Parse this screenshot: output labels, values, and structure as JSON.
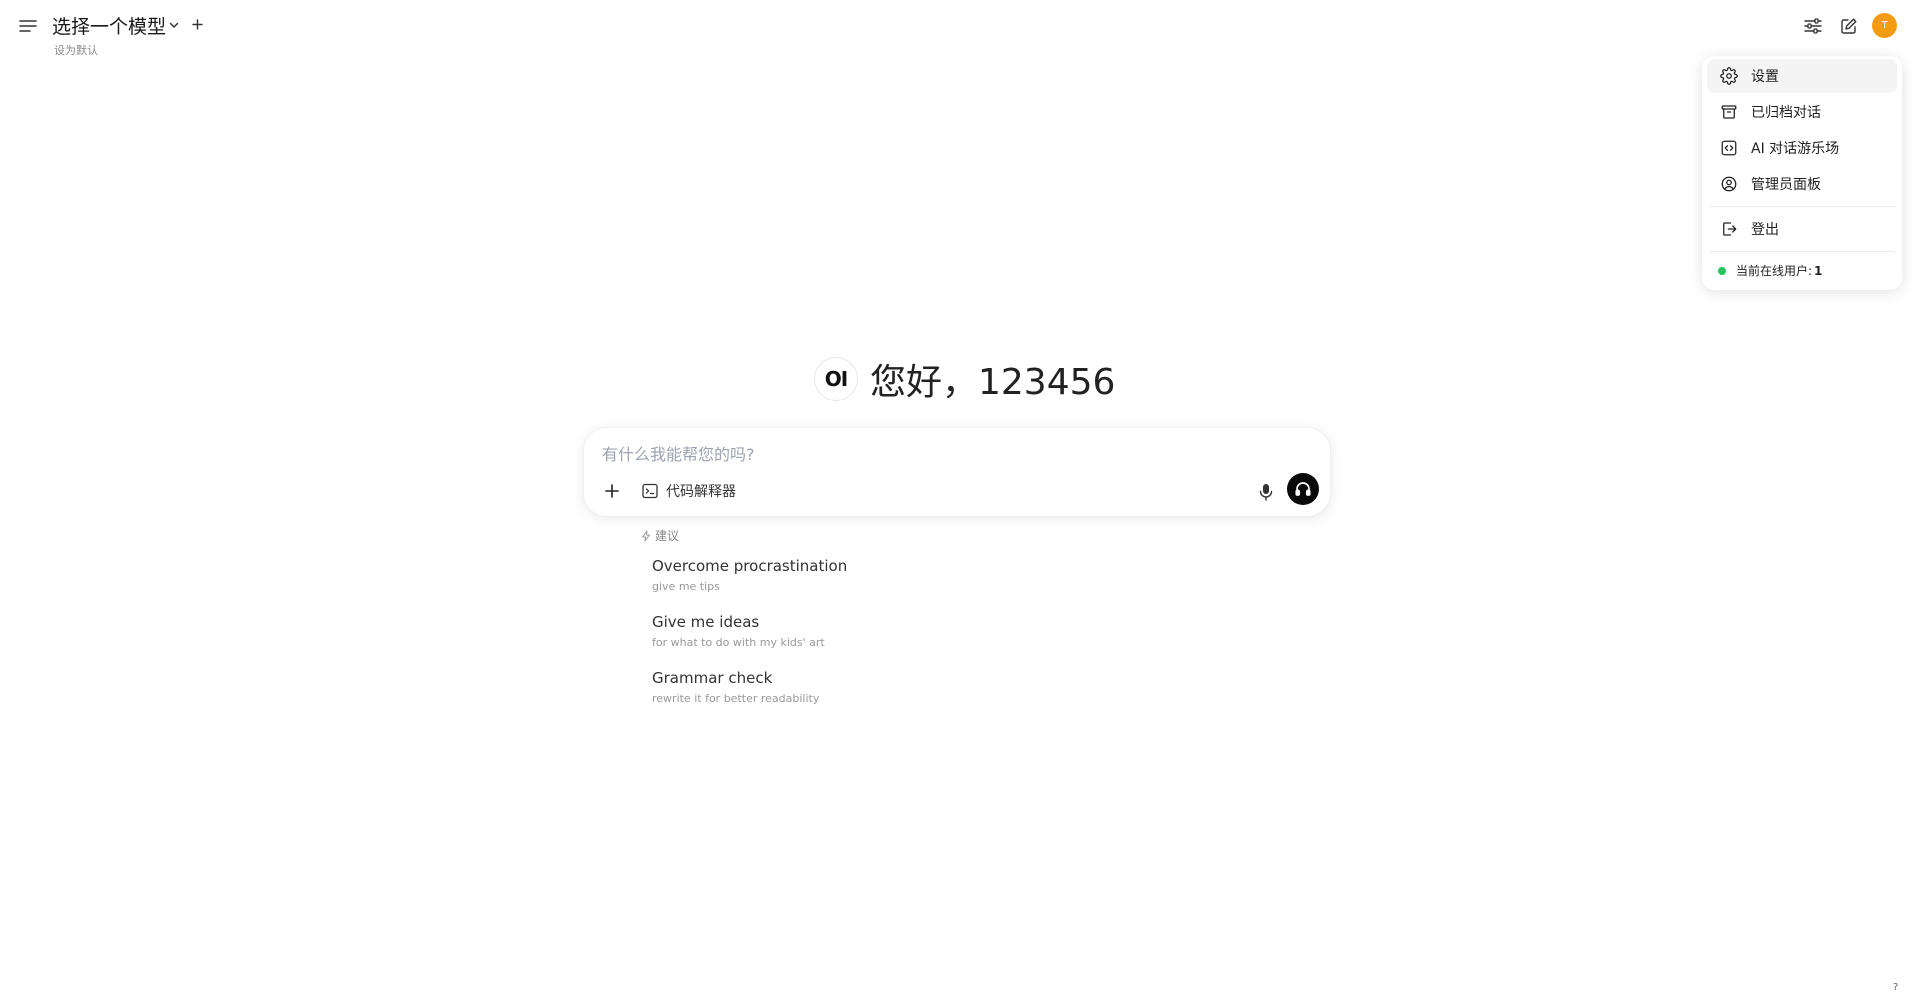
{
  "header": {
    "model_selector": "选择一个模型",
    "set_default": "设为默认"
  },
  "user": {
    "avatar_initial": "T",
    "avatar_color": "#f39c12"
  },
  "user_menu": {
    "items": [
      {
        "label": "设置",
        "icon": "gear-icon"
      },
      {
        "label": "已归档对话",
        "icon": "archive-icon"
      },
      {
        "label": "AI 对话游乐场",
        "icon": "code-bracket-icon"
      },
      {
        "label": "管理员面板",
        "icon": "user-circle-icon"
      },
      {
        "label": "登出",
        "icon": "logout-icon"
      }
    ],
    "online_label": "当前在线用户: ",
    "online_count": "1"
  },
  "greeting": {
    "logo": "OI",
    "text": "您好，123456"
  },
  "chat_input": {
    "placeholder": "有什么我能帮您的吗?",
    "value": "",
    "code_interpreter_label": "代码解释器"
  },
  "suggestions": {
    "heading": "建议",
    "items": [
      {
        "title": "Overcome procrastination",
        "subtitle": "give me tips"
      },
      {
        "title": "Give me ideas",
        "subtitle": "for what to do with my kids' art"
      },
      {
        "title": "Grammar check",
        "subtitle": "rewrite it for better readability"
      }
    ]
  },
  "help_label": "?"
}
